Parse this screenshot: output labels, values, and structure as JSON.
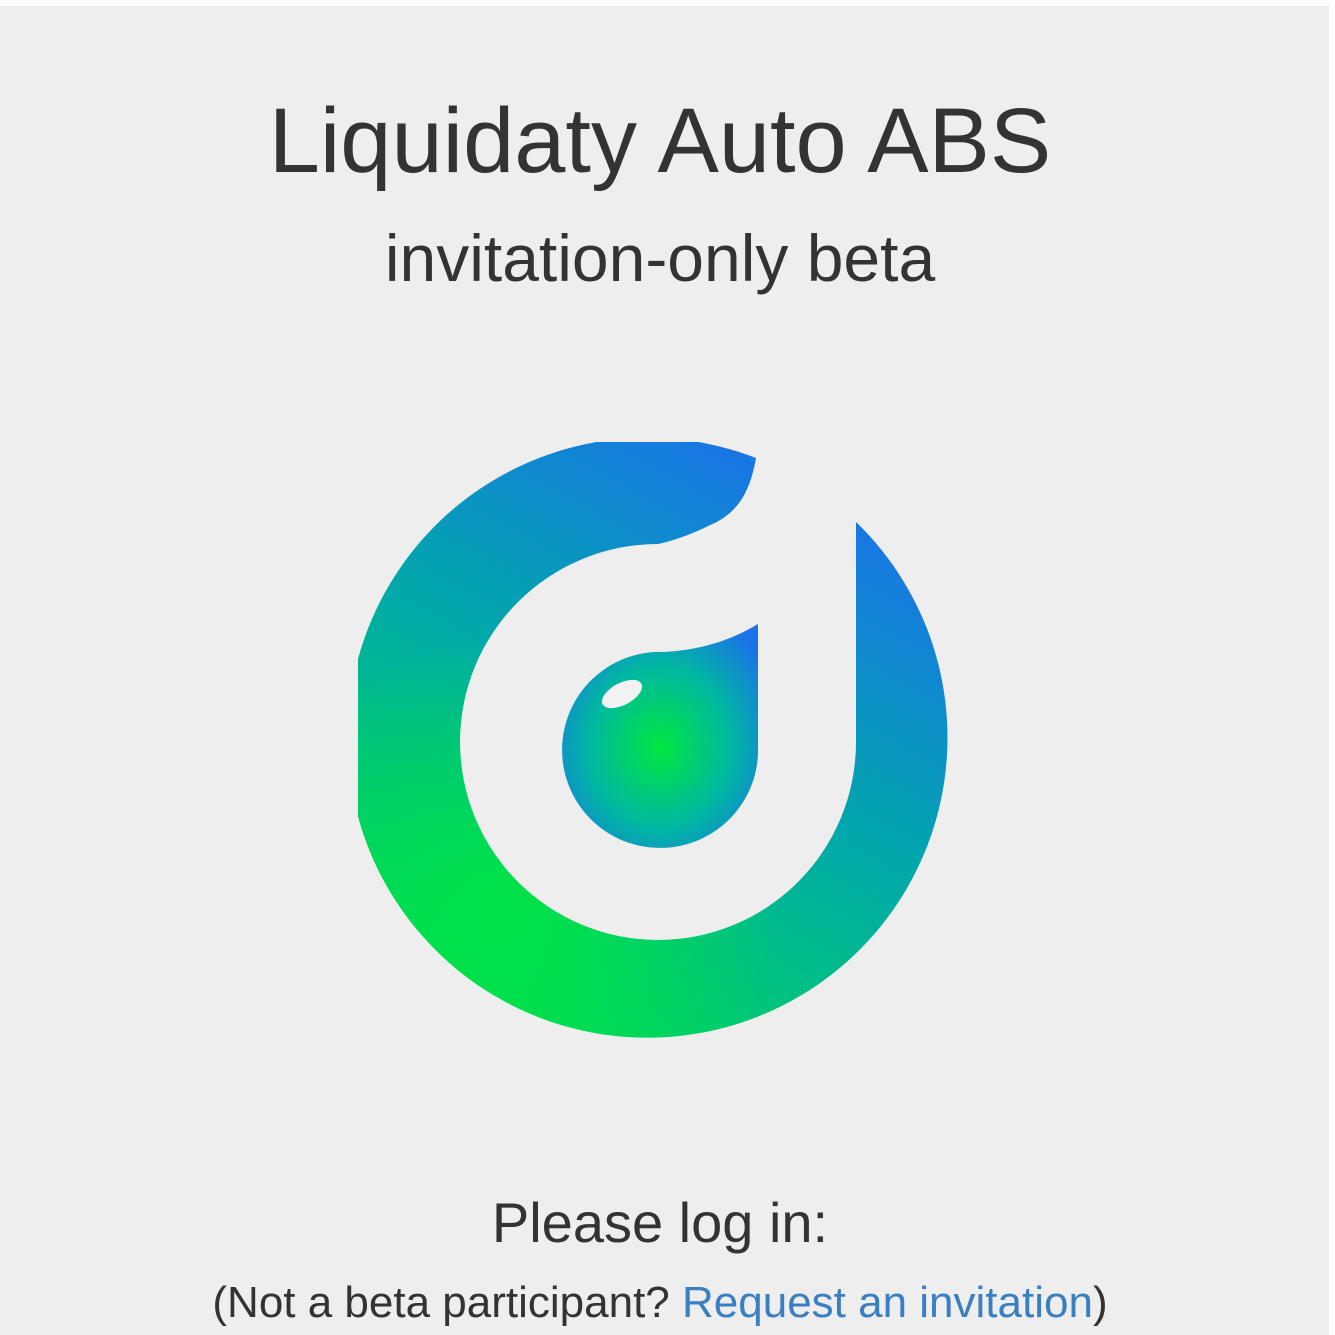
{
  "header": {
    "title": "Liquidaty Auto ABS",
    "subtitle": "invitation-only beta"
  },
  "logo": {
    "icon": "liquidaty-drop-logo-icon",
    "colors": {
      "blue": "#1a73e8",
      "teal": "#00aaa8",
      "green": "#00e640"
    }
  },
  "login": {
    "prompt": "Please log in:",
    "invite_prefix": "(Not a beta participant? ",
    "invite_link": "Request an invitation",
    "invite_suffix": ")",
    "link_color": "#3a7fc1"
  }
}
